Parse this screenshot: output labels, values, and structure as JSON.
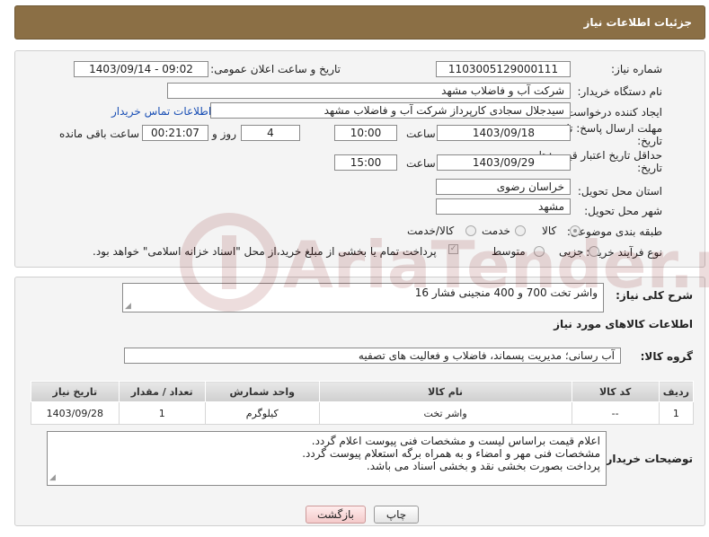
{
  "header": {
    "title": "جزئیات اطلاعات نیاز"
  },
  "need_number": {
    "label": "شماره نیاز:",
    "value": "1103005129000111"
  },
  "announce": {
    "label": "تاریخ و ساعت اعلان عمومی:",
    "value": "1403/09/14 - 09:02"
  },
  "buyer_org": {
    "label": "نام دستگاه خریدار:",
    "value": "شرکت آب و فاضلاب مشهد"
  },
  "creator": {
    "label": "ایجاد کننده درخواست:",
    "value": "سیدجلال سجادی کارپرداز شرکت آب و فاضلاب مشهد",
    "contact_link": "اطلاعات تماس خریدار"
  },
  "reply_deadline": {
    "label_line1": "مهلت ارسال پاسخ: تا",
    "label_line2": "تاریخ:",
    "date": "1403/09/18",
    "time_label": "ساعت",
    "time": "10:00",
    "days": "4",
    "days_label": "روز و",
    "remaining": "00:21:07",
    "remaining_label": "ساعت باقی مانده"
  },
  "price_validity": {
    "label_line1": "حداقل تاریخ اعتبار قیمت: تا",
    "label_line2": "تاریخ:",
    "date": "1403/09/29",
    "time_label": "ساعت",
    "time": "15:00"
  },
  "province": {
    "label": "استان محل تحویل:",
    "value": "خراسان رضوی"
  },
  "city": {
    "label": "شهر محل تحویل:",
    "value": "مشهد"
  },
  "category": {
    "label": "طبقه بندی موضوعی:",
    "options": [
      "کالا",
      "خدمت",
      "کالا/خدمت"
    ],
    "selected": "کالا"
  },
  "purchase_type": {
    "label": "نوع فرآیند خرید :",
    "options": [
      "جزیی",
      "متوسط"
    ],
    "payment_note": "پرداخت تمام یا بخشی از مبلغ خرید،از محل \"اسناد خزانه اسلامی\" خواهد بود."
  },
  "description": {
    "label": "شرح کلی نیاز:",
    "value": "واشر تخت 700 و 400 منجینی فشار 16"
  },
  "goods_info": {
    "title": "اطلاعات کالاهای مورد نیاز"
  },
  "goods_group": {
    "label": "گروه کالا:",
    "value": "آب رسانی؛ مدیریت پسماند، فاضلاب و فعالیت های تصفیه"
  },
  "table": {
    "headers": [
      "ردیف",
      "کد کالا",
      "نام کالا",
      "واحد شمارش",
      "تعداد / مقدار",
      "تاریخ نیاز"
    ],
    "rows": [
      [
        "1",
        "--",
        "واشر تخت",
        "کیلوگرم",
        "1",
        "1403/09/28"
      ]
    ]
  },
  "buyer_notes": {
    "label": "توضیحات خریدار:",
    "lines": [
      "اعلام قیمت براساس لیست و مشخصات فنی پیوست اعلام گردد.",
      "مشخصات فنی مهر و امضاء و به همراه برگه استعلام پیوست گردد.",
      "پرداخت بصورت بخشی نقد و بخشی اسناد می باشد."
    ]
  },
  "buttons": {
    "print": "چاپ",
    "back": "بازگشت"
  },
  "watermark": {
    "text": "AriaTender.neT"
  }
}
